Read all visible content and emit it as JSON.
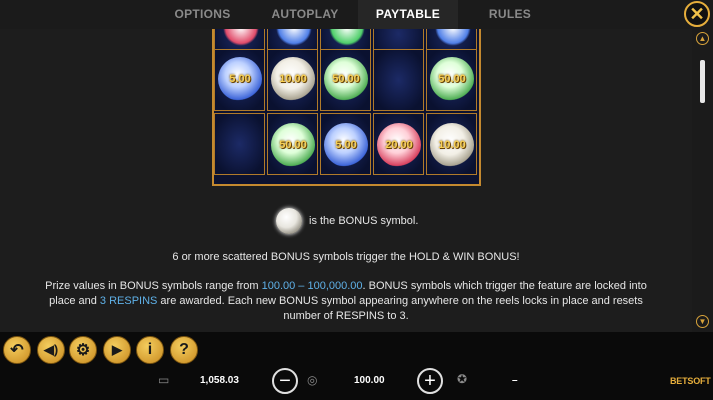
{
  "tabs": [
    {
      "label": "OPTIONS"
    },
    {
      "label": "AUTOPLAY"
    },
    {
      "label": "PAYTABLE"
    },
    {
      "label": "RULES"
    }
  ],
  "close_icon": "close-icon",
  "reels": {
    "row1": [
      "5.00",
      "10.00",
      "50.00",
      "",
      "50.00"
    ],
    "row2": [
      "",
      "50.00",
      "5.00",
      "20.00",
      "10.00"
    ]
  },
  "content": {
    "bonus_line": "is the BONUS symbol.",
    "trigger_line": "6 or more scattered BONUS symbols trigger the HOLD & WIN BONUS!",
    "prize_pre": "Prize values in BONUS symbols range from ",
    "prize_range": "100.00 – 100,000.00",
    "prize_post": ". BONUS symbols which trigger the feature are locked into",
    "prize_line2_pre": "place and ",
    "respins": "3 RESPINS",
    "prize_line2_post": " are awarded. Each new BONUS symbol appearing anywhere on the reels locks in place and resets",
    "prize_line3": "number of RESPINS to 3."
  },
  "footer": {
    "balance": "1,058.03",
    "bet": "100.00",
    "win": "–",
    "brand": "BETSOFT"
  },
  "colors": {
    "accent": "#e6ae3c",
    "highlight": "#5fb1e8"
  }
}
